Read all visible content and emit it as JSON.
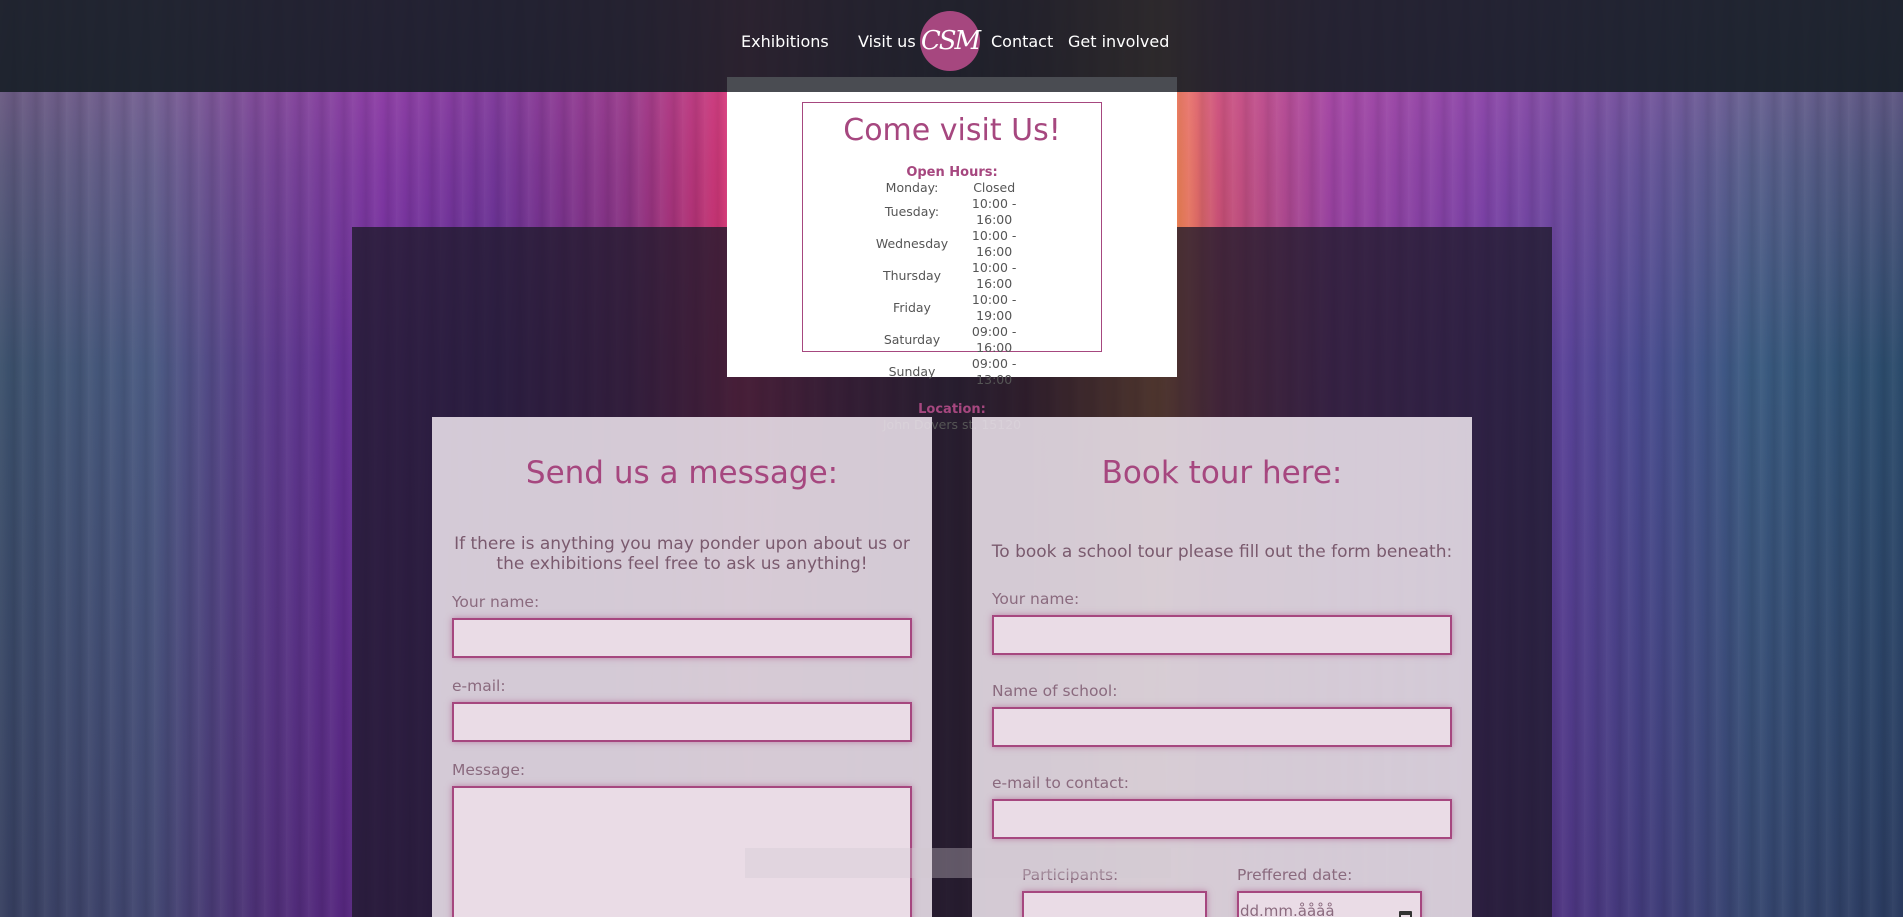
{
  "nav": {
    "items": [
      "Exhibitions",
      "Visit us",
      "Contact",
      "Get involved"
    ],
    "logo_text": "CSM"
  },
  "visit_card": {
    "title": "Come visit Us!",
    "hours_label": "Open Hours:",
    "hours": [
      {
        "day": "Monday:",
        "time": "Closed"
      },
      {
        "day": "Tuesday:",
        "time": "10:00 - 16:00"
      },
      {
        "day": "Wednesday",
        "time": "10:00 - 16:00"
      },
      {
        "day": "Thursday",
        "time": "10:00 - 16:00"
      },
      {
        "day": "Friday",
        "time": "10:00 - 19:00"
      },
      {
        "day": "Saturday",
        "time": "09:00 - 16:00"
      },
      {
        "day": "Sunday",
        "time": "09:00 - 13:00"
      }
    ],
    "location_label": "Location:",
    "location": "John Dovers st. 15120"
  },
  "message_form": {
    "title": "Send us a message:",
    "description": "If there is anything you may ponder upon about us or the exhibitions feel free to ask us anything!",
    "name_label": "Your name:",
    "email_label": "e-mail:",
    "message_label": "Message:"
  },
  "tour_form": {
    "title": "Book tour here:",
    "description": "To book a school tour please fill out the form beneath:",
    "name_label": "Your name:",
    "school_label": "Name of school:",
    "email_label": "e-mail to contact:",
    "participants_label": "Participants:",
    "date_label": "Preffered date:",
    "date_placeholder": "dd.mm.åååå"
  },
  "colors": {
    "accent": "#a6477f",
    "topbar": "#161e26",
    "card": "#ffffff"
  }
}
